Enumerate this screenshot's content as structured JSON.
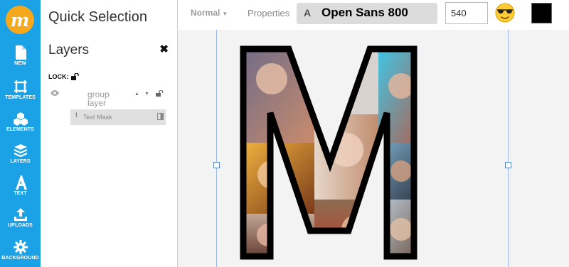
{
  "app": {
    "logo_letter": "m"
  },
  "nav": {
    "items": [
      {
        "label": "NEW",
        "icon": "file-icon"
      },
      {
        "label": "TEMPLATES",
        "icon": "templates-icon"
      },
      {
        "label": "ELEMENTS",
        "icon": "elements-icon"
      },
      {
        "label": "LAYERS",
        "icon": "layers-icon"
      },
      {
        "label": "TEXT",
        "icon": "text-icon"
      },
      {
        "label": "UPLOADS",
        "icon": "upload-icon"
      },
      {
        "label": "BACKGROUND",
        "icon": "gear-icon"
      }
    ]
  },
  "panel": {
    "title": "Quick Selection",
    "layers_title": "Layers",
    "close_label": "✖",
    "lock_label": "LOCK:",
    "group_label": "group layer",
    "mask_icon_letter": "t",
    "mask_label": "Text Mask"
  },
  "toolbar": {
    "blend_mode": "Normal",
    "properties_label": "Properties",
    "font_icon_letter": "A",
    "font_name": "Open Sans 800",
    "font_size": "540",
    "color": "#000000"
  },
  "canvas": {
    "mask_text": "M"
  },
  "colors": {
    "rail": "#1aa1e6",
    "logo": "#f6a81c"
  }
}
